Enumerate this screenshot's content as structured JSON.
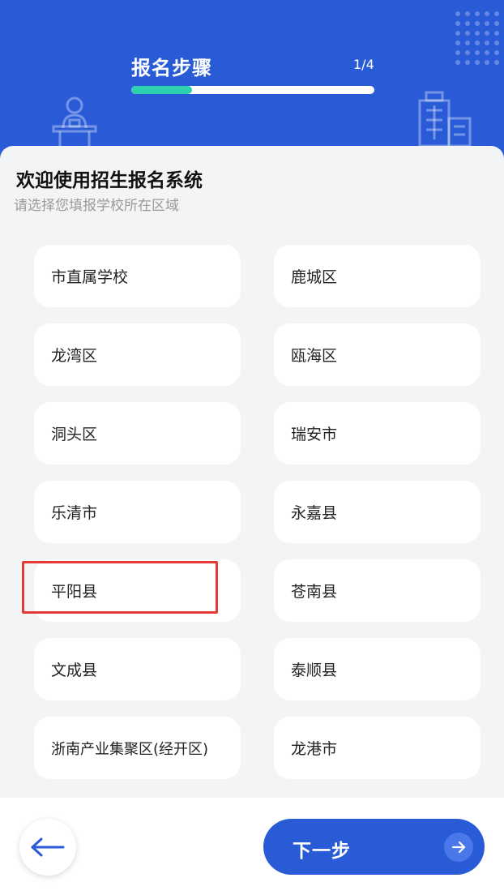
{
  "header": {
    "title": "报名步骤",
    "step_indicator": "1/4",
    "progress_fraction": 0.25
  },
  "intro": {
    "title": "欢迎使用招生报名系统",
    "subtitle": "请选择您填报学校所在区域"
  },
  "regions": [
    {
      "label": "市直属学校"
    },
    {
      "label": "鹿城区"
    },
    {
      "label": "龙湾区"
    },
    {
      "label": "瓯海区"
    },
    {
      "label": "洞头区"
    },
    {
      "label": "瑞安市"
    },
    {
      "label": "乐清市"
    },
    {
      "label": "永嘉县"
    },
    {
      "label": "平阳县"
    },
    {
      "label": "苍南县"
    },
    {
      "label": "文成县"
    },
    {
      "label": "泰顺县"
    },
    {
      "label": "浙南产业集聚区(经开区)"
    },
    {
      "label": "龙港市"
    }
  ],
  "footer": {
    "back_icon": "arrow-left-icon",
    "next_label": "下一步",
    "next_icon": "arrow-right-icon"
  },
  "colors": {
    "primary": "#2a5bd7",
    "progress": "#2fd0b0",
    "highlight": "#e53935"
  }
}
